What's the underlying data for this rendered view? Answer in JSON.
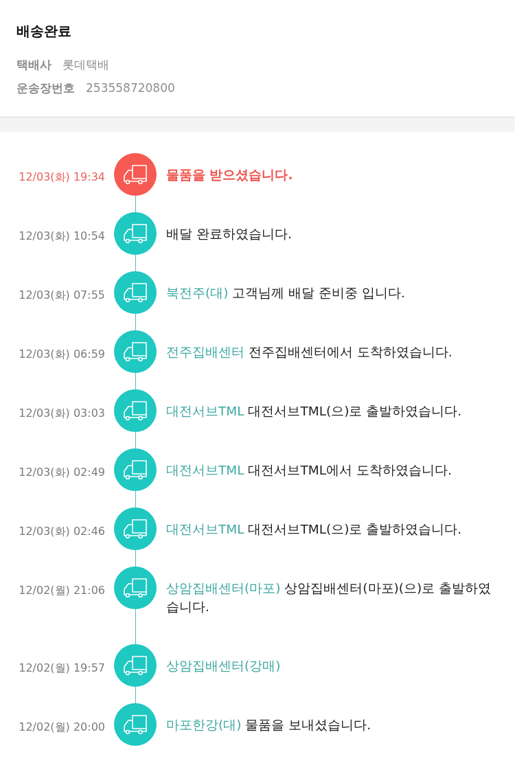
{
  "header": {
    "title": "배송완료",
    "info": [
      {
        "label": "택배사",
        "value": "롯데택배"
      },
      {
        "label": "운송장번호",
        "value": "253558720800"
      }
    ]
  },
  "timeline": [
    {
      "time": "12/03(화) 19:34",
      "message": "물품을 받으셨습니다.",
      "highlighted": true
    },
    {
      "time": "12/03(화) 10:54",
      "message": "배달 완료하였습니다.",
      "highlighted": false
    },
    {
      "time": "12/03(화) 07:55",
      "location": "북전주(대)",
      "message": "고객님께 배달 준비중 입니다.",
      "highlighted": false
    },
    {
      "time": "12/03(화) 06:59",
      "location": "전주집배센터",
      "message": "전주집배센터에서 도착하였습니다.",
      "highlighted": false
    },
    {
      "time": "12/03(화) 03:03",
      "location": "대전서브TML",
      "message": "대전서브TML(으)로 출발하였습니다.",
      "highlighted": false
    },
    {
      "time": "12/03(화) 02:49",
      "location": "대전서브TML",
      "message": "대전서브TML에서 도착하였습니다.",
      "highlighted": false
    },
    {
      "time": "12/03(화) 02:46",
      "location": "대전서브TML",
      "message": "대전서브TML(으)로 출발하였습니다.",
      "highlighted": false
    },
    {
      "time": "12/02(월) 21:06",
      "location": "상암집배센터(마포)",
      "message": "상암집배센터(마포)(으)로 출발하였습니다.",
      "highlighted": false
    },
    {
      "time": "12/02(월) 19:57",
      "location": "상암집배센터(강매)",
      "highlighted": false
    },
    {
      "time": "12/02(월) 20:00",
      "location": "마포한강(대)",
      "message": "물품을 보내셨습니다.",
      "highlighted": false
    }
  ]
}
